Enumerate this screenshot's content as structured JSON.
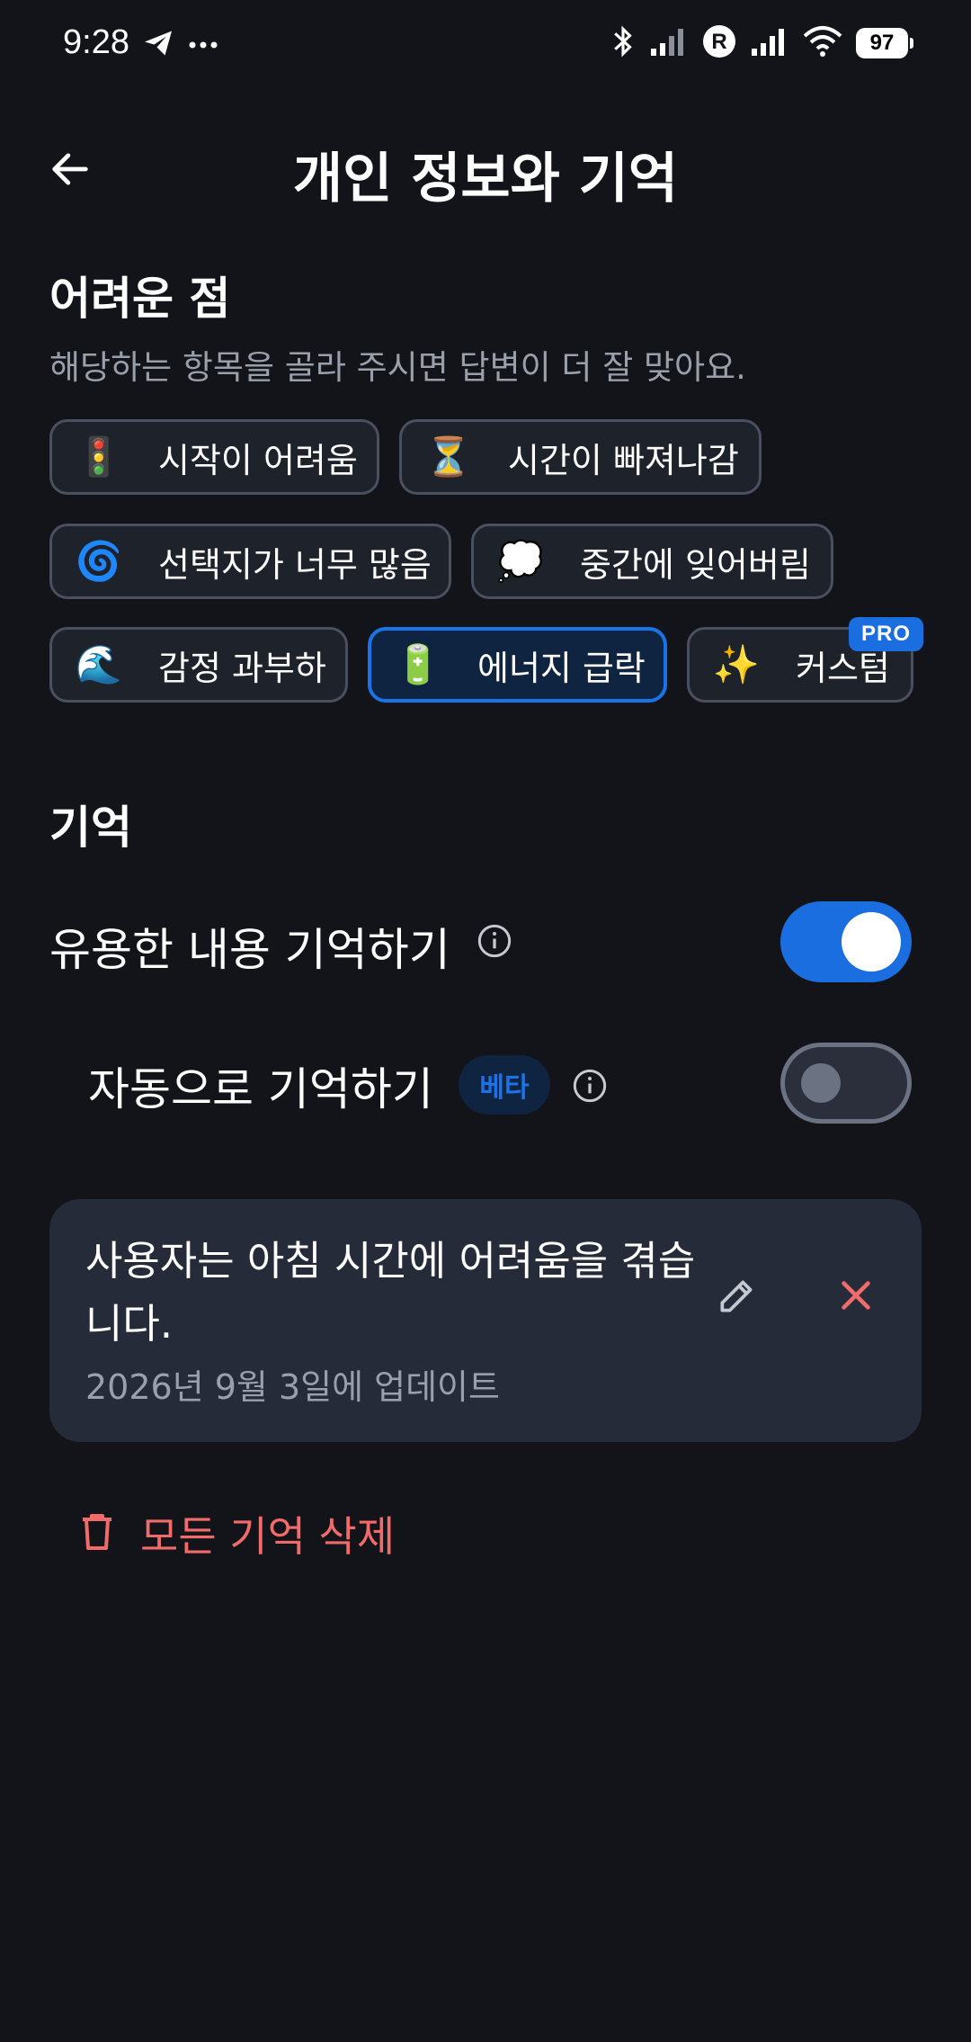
{
  "status_bar": {
    "time": "9:28",
    "battery": "97",
    "icons": [
      "telegram-icon",
      "more-dots-icon",
      "bluetooth-icon",
      "signal-icon",
      "roaming-r-icon",
      "signal-icon",
      "wifi-icon",
      "battery-icon"
    ]
  },
  "header": {
    "title": "개인 정보와 기억",
    "back_icon": "arrow-left-icon"
  },
  "difficulty": {
    "title": "어려운 점",
    "description": "해당하는 항목을 골라 주시면 답변이 더 잘 맞아요.",
    "chips": [
      {
        "emoji": "🚦",
        "label": "시작이 어려움",
        "selected": false
      },
      {
        "emoji": "⏳",
        "label": "시간이 빠져나감",
        "selected": false
      },
      {
        "emoji": "🌀",
        "label": "선택지가 너무 많음",
        "selected": false
      },
      {
        "emoji": "💭",
        "label": "중간에 잊어버림",
        "selected": false
      },
      {
        "emoji": "🌊",
        "label": "감정 과부하",
        "selected": false
      },
      {
        "emoji": "🔋",
        "label": "에너지 급락",
        "selected": true
      },
      {
        "emoji": "✨",
        "label": "커스텀",
        "selected": false,
        "badge": "PRO"
      }
    ]
  },
  "memory": {
    "title": "기억",
    "remember_useful": {
      "label": "유용한 내용 기억하기",
      "enabled": true
    },
    "auto_remember": {
      "label": "자동으로 기억하기",
      "badge": "베타",
      "enabled": false
    },
    "entries": [
      {
        "text": "사용자는 아침 시간에 어려움을 겪습니다.",
        "date": "2026년 9월 3일에 업데이트"
      }
    ],
    "delete_all_label": "모든 기억 삭제"
  },
  "colors": {
    "background": "#12141a",
    "accent": "#1a6ee0",
    "danger": "#f26b6b",
    "card": "#262b39",
    "muted_text": "#9aa0ab"
  }
}
